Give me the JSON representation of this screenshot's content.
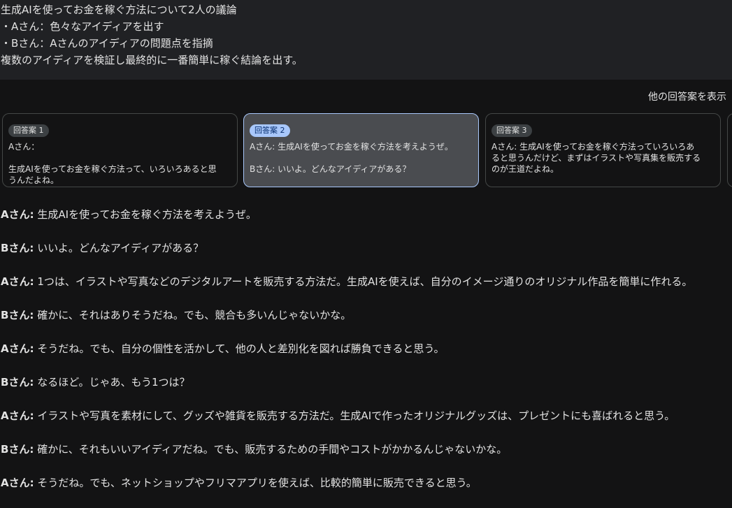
{
  "prompt": {
    "lines": [
      "生成AIを使ってお金を稼ぐ方法について2人の議論",
      "・Aさん：色々なアイディアを出す",
      "・Bさん：Aさんのアイディアの問題点を指摘",
      "複数のアイディアを検証し最終的に一番簡単に稼ぐ結論を出す。"
    ]
  },
  "other_drafts_label": "他の回答案を表示",
  "drafts": [
    {
      "chip": "回答案 1",
      "text": "Aさん：\n\n生成AIを使ってお金を稼ぐ方法って、いろいろあると思うんだよね。"
    },
    {
      "chip": "回答案 2",
      "text": "Aさん: 生成AIを使ってお金を稼ぐ方法を考えようぜ。\n\nBさん: いいよ。どんなアイディアがある？"
    },
    {
      "chip": "回答案 3",
      "text": "Aさん: 生成AIを使ってお金を稼ぐ方法っていろいろあると思うんだけど、まずはイラストや写真集を販売するのが王道だよね。"
    }
  ],
  "response": {
    "lines": [
      {
        "speaker": "Aさん:",
        "text": " 生成AIを使ってお金を稼ぐ方法を考えようぜ。"
      },
      {
        "speaker": "Bさん:",
        "text": " いいよ。どんなアイディアがある？"
      },
      {
        "speaker": "Aさん:",
        "text": " 1つは、イラストや写真などのデジタルアートを販売する方法だ。生成AIを使えば、自分のイメージ通りのオリジナル作品を簡単に作れる。"
      },
      {
        "speaker": "Bさん:",
        "text": " 確かに、それはありそうだね。でも、競合も多いんじゃないかな。"
      },
      {
        "speaker": "Aさん:",
        "text": " そうだね。でも、自分の個性を活かして、他の人と差別化を図れば勝負できると思う。"
      },
      {
        "speaker": "Bさん:",
        "text": " なるほど。じゃあ、もう1つは？"
      },
      {
        "speaker": "Aさん:",
        "text": " イラストや写真を素材にして、グッズや雑貨を販売する方法だ。生成AIで作ったオリジナルグッズは、プレゼントにも喜ばれると思う。"
      },
      {
        "speaker": "Bさん:",
        "text": " 確かに、それもいいアイディアだね。でも、販売するための手間やコストがかかるんじゃないかな。"
      },
      {
        "speaker": "Aさん:",
        "text": " そうだね。でも、ネットショップやフリマアプリを使えば、比較的簡単に販売できると思う。"
      }
    ]
  }
}
